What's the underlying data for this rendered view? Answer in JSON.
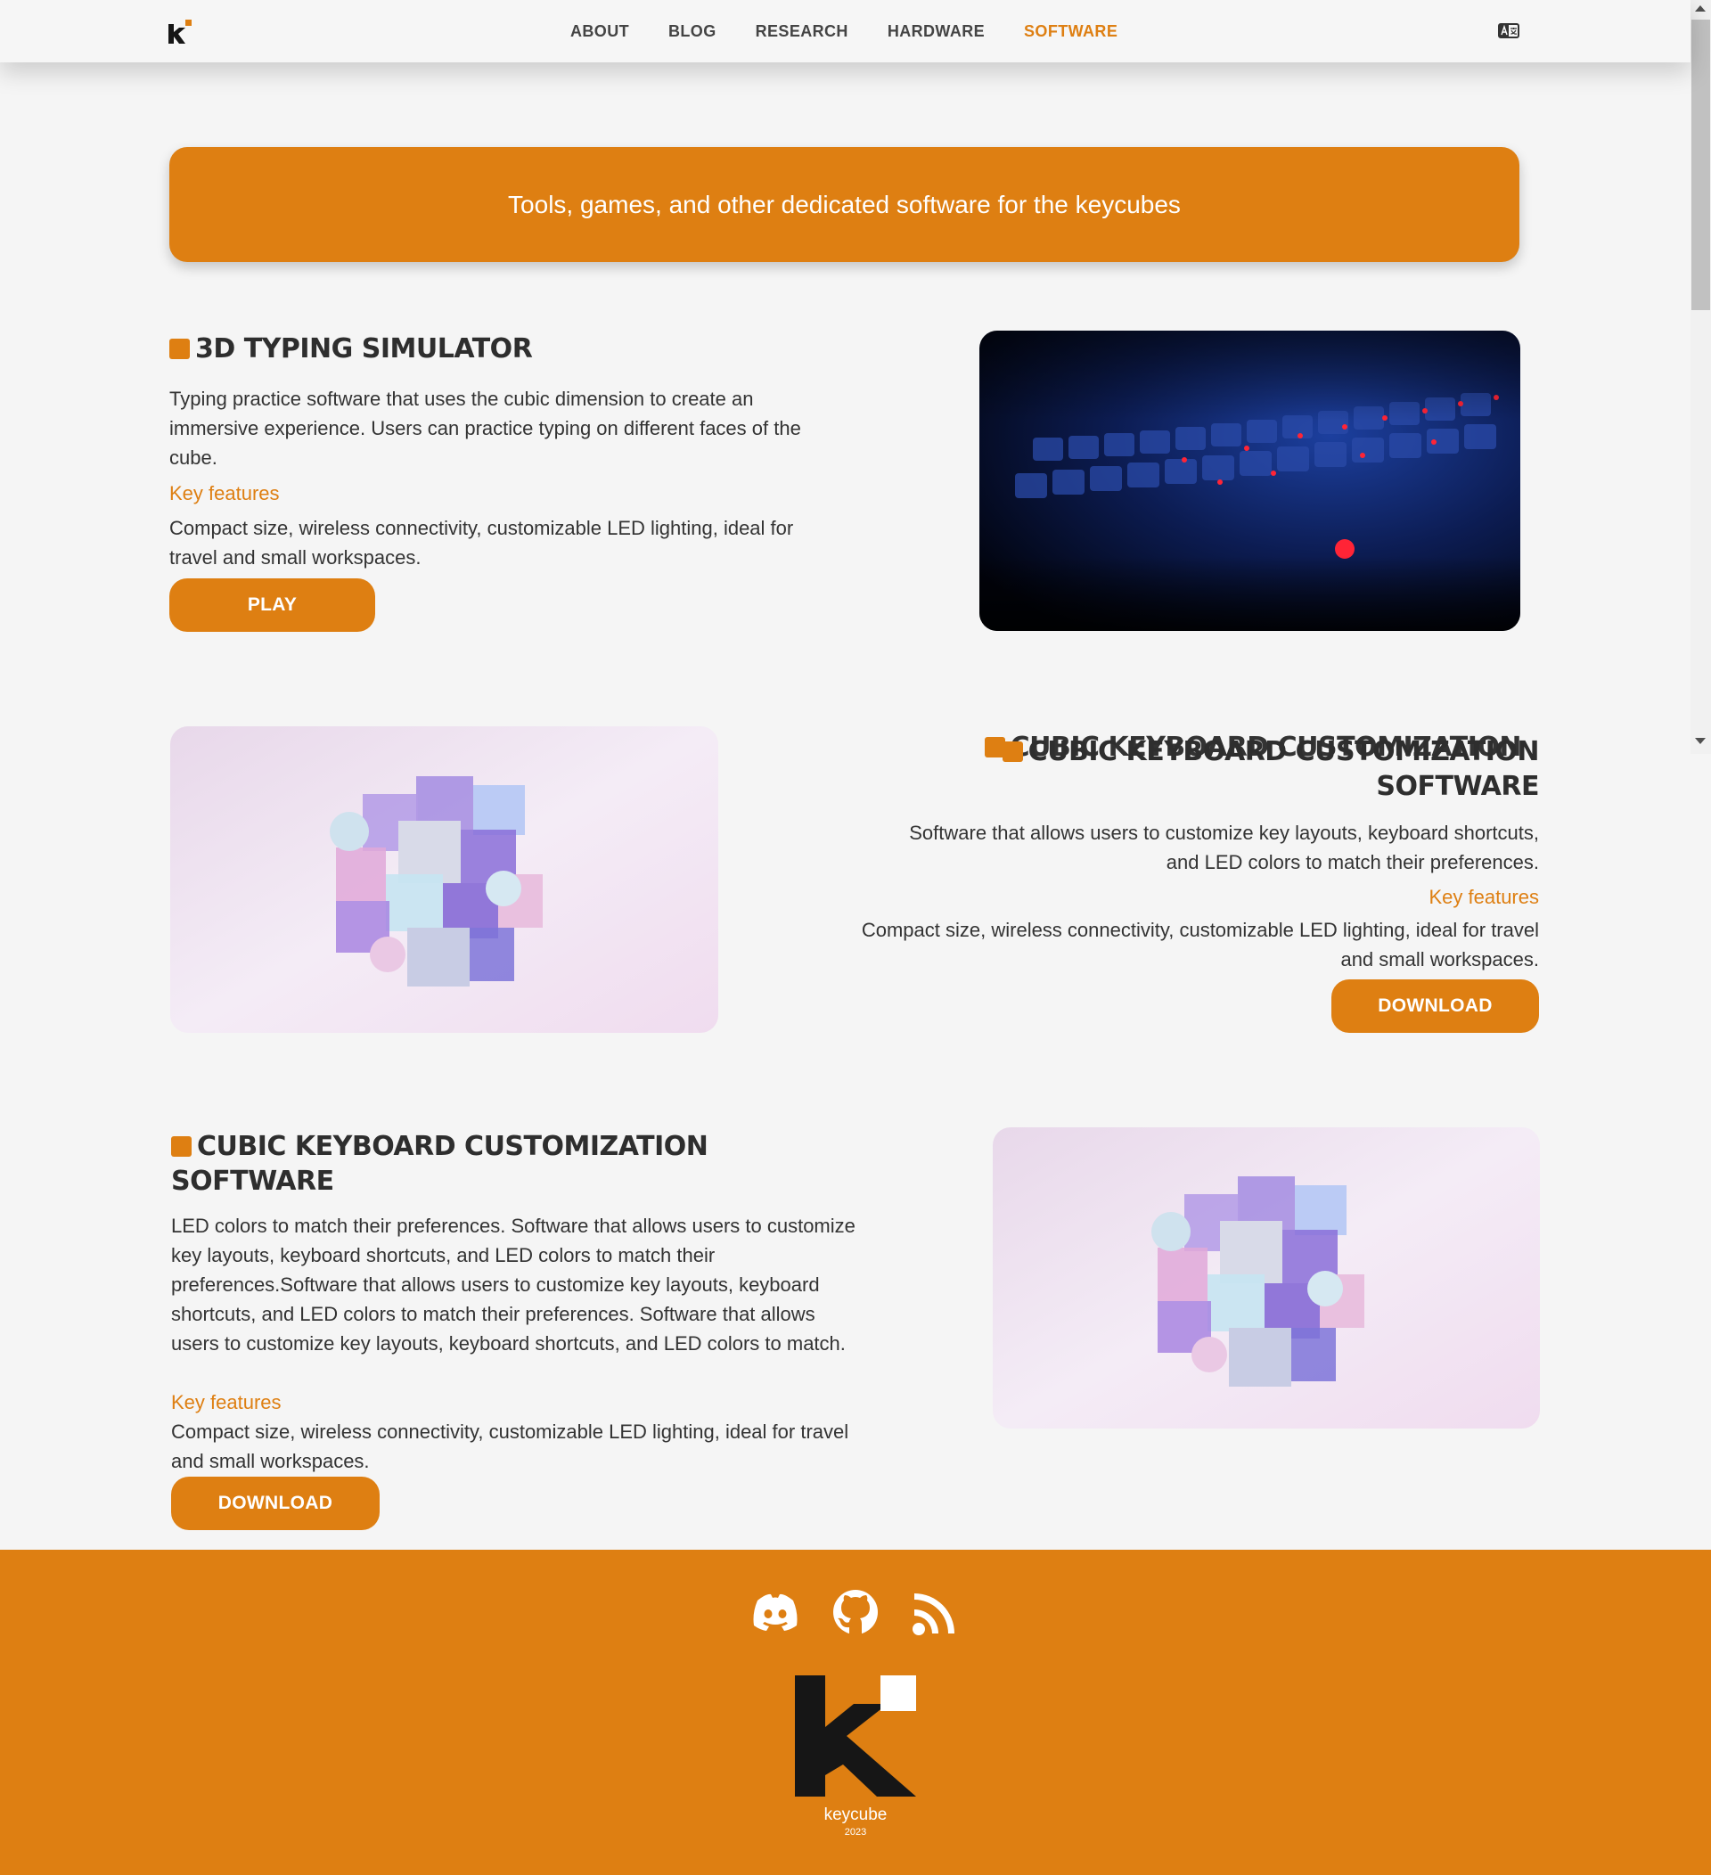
{
  "nav": {
    "items": [
      "ABOUT",
      "BLOG",
      "RESEARCH",
      "HARDWARE",
      "SOFTWARE"
    ],
    "active": "SOFTWARE"
  },
  "banner": {
    "text": "Tools, games, and other dedicated software for the keycubes"
  },
  "sections": [
    {
      "title": "3D TYPING SIMULATOR",
      "description": "Typing practice software that uses the cubic dimension to create an immersive experience. Users can practice typing on different faces of the cube.",
      "key_features_label": "Key features",
      "features": "Compact size, wireless connectivity, customizable LED lighting, ideal for travel and small workspaces.",
      "button": "PLAY",
      "image_icon": "keyboard-photo"
    },
    {
      "title_overlap": "CUBIC KEYBOARD CUSTOMIZATION",
      "title_line1": "CUBIC KEYBOARD CUSTOMIZATION",
      "title_line2": "SOFTWARE",
      "description": "Software that allows users to customize key layouts, keyboard shortcuts, and LED colors to match their preferences.",
      "key_features_label": "Key features",
      "features": "Compact size, wireless connectivity, customizable LED lighting, ideal for travel and small workspaces.",
      "button": "DOWNLOAD",
      "image_icon": "glass-cube-render"
    },
    {
      "title": "CUBIC KEYBOARD CUSTOMIZATION SOFTWARE",
      "description": "LED colors to match their preferences. Software that allows users to customize key layouts, keyboard shortcuts, and LED colors to match their preferences.Software that allows users to customize key layouts, keyboard shortcuts, and LED colors to match their preferences. Software that allows users to customize key layouts, keyboard shortcuts, and LED colors to match.",
      "key_features_label": "Key features",
      "features": "Compact size, wireless connectivity, customizable LED lighting, ideal for travel and small workspaces.",
      "button": "DOWNLOAD",
      "image_icon": "glass-cube-render"
    }
  ],
  "footer": {
    "icons": [
      "discord-icon",
      "github-icon",
      "rss-icon"
    ],
    "brand": "keycube",
    "year": "2023"
  },
  "colors": {
    "accent": "#de7f12",
    "background": "#f5f5f5",
    "text": "#333333"
  }
}
